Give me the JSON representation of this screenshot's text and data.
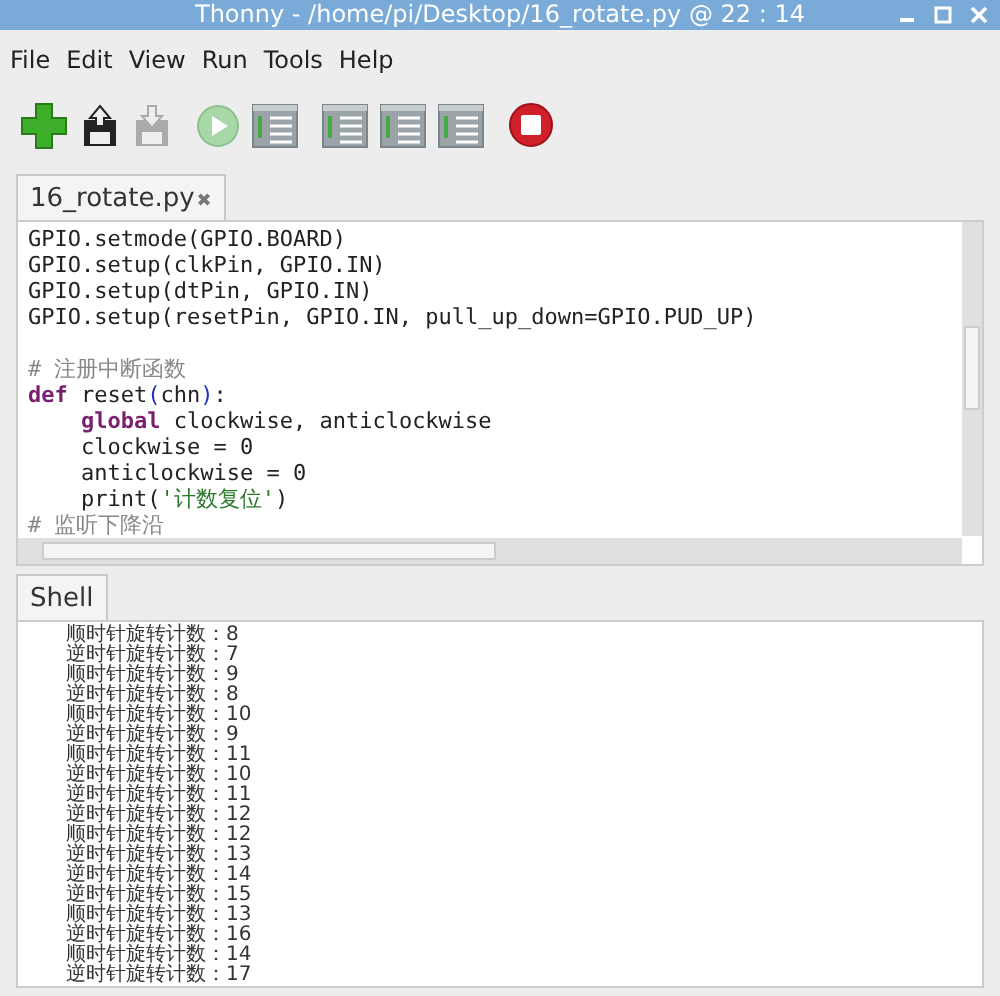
{
  "window": {
    "title": "Thonny  -  /home/pi/Desktop/16_rotate.py  @  22 : 14"
  },
  "menu": [
    "File",
    "Edit",
    "View",
    "Run",
    "Tools",
    "Help"
  ],
  "editor": {
    "tab": {
      "label": "16_rotate.py",
      "close": "✖",
      "selected": true
    },
    "lines": [
      [
        {
          "kind": "plain",
          "text": "GPIO.setmode(GPIO.BOARD)"
        }
      ],
      [
        {
          "kind": "plain",
          "text": "GPIO.setup(clkPin, GPIO.IN)"
        }
      ],
      [
        {
          "kind": "plain",
          "text": "GPIO.setup(dtPin, GPIO.IN)"
        }
      ],
      [
        {
          "kind": "plain",
          "text": "GPIO.setup(resetPin, GPIO.IN, pull_up_down=GPIO.PUD_UP)"
        }
      ],
      {
        "blank": true
      },
      [
        {
          "kind": "comment",
          "text": "# 注册中断函数"
        }
      ],
      [
        {
          "kind": "keyword",
          "text": "def"
        },
        {
          "kind": "plain",
          "text": " reset"
        },
        {
          "kind": "paren",
          "text": "("
        },
        {
          "kind": "plain",
          "text": "chn"
        },
        {
          "kind": "paren",
          "text": ")"
        },
        {
          "kind": "plain",
          "text": ":"
        }
      ],
      {
        "indent": true,
        "tokens": [
          {
            "kind": "keyword",
            "text": "global"
          },
          {
            "kind": "plain",
            "text": " clockwise, anticlockwise"
          }
        ]
      },
      {
        "indent": true,
        "tokens": [
          {
            "kind": "plain",
            "text": "clockwise = 0"
          }
        ]
      },
      {
        "indent": true,
        "tokens": [
          {
            "kind": "plain",
            "text": "anticlockwise = 0"
          }
        ]
      },
      {
        "indent": true,
        "tokens": [
          {
            "kind": "plain",
            "text": "print("
          },
          {
            "kind": "string",
            "text": "'计数复位'"
          },
          {
            "kind": "plain",
            "text": ")"
          }
        ]
      },
      [
        {
          "kind": "comment",
          "text": "# 监听下降沿"
        }
      ]
    ]
  },
  "shell": {
    "tab": {
      "label": "Shell",
      "selected": true
    },
    "lines": [
      "顺时针旋转计数：8",
      "逆时针旋转计数：7",
      "顺时针旋转计数：9",
      "逆时针旋转计数：8",
      "顺时针旋转计数：10",
      "逆时针旋转计数：9",
      "顺时针旋转计数：11",
      "逆时针旋转计数：10",
      "逆时针旋转计数：11",
      "逆时针旋转计数：12",
      "顺时针旋转计数：12",
      "逆时针旋转计数：13",
      "逆时针旋转计数：14",
      "逆时针旋转计数：15",
      "顺时针旋转计数：13",
      "逆时针旋转计数：16",
      "顺时针旋转计数：14",
      "逆时针旋转计数：17"
    ]
  }
}
